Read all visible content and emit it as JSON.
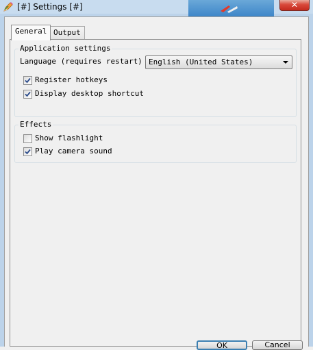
{
  "window": {
    "title": "[#] Settings [#]",
    "close_glyph": "✕",
    "icon": "pencil-icon"
  },
  "tabs": [
    {
      "label": "General",
      "active": true
    },
    {
      "label": "Output",
      "active": false
    }
  ],
  "application_settings": {
    "title": "Application settings",
    "language_label": "Language (requires restart)",
    "language_value": "English (United States)",
    "checkboxes": [
      {
        "label": "Register hotkeys",
        "checked": true
      },
      {
        "label": "Display desktop shortcut",
        "checked": true
      }
    ]
  },
  "effects": {
    "title": "Effects",
    "checkboxes": [
      {
        "label": "Show flashlight",
        "checked": false
      },
      {
        "label": "Play camera sound",
        "checked": true
      }
    ]
  },
  "buttons": {
    "ok": "OK",
    "cancel": "Cancel"
  },
  "colors": {
    "accent": "#3c7fb1",
    "check": "#2a4a8a"
  }
}
